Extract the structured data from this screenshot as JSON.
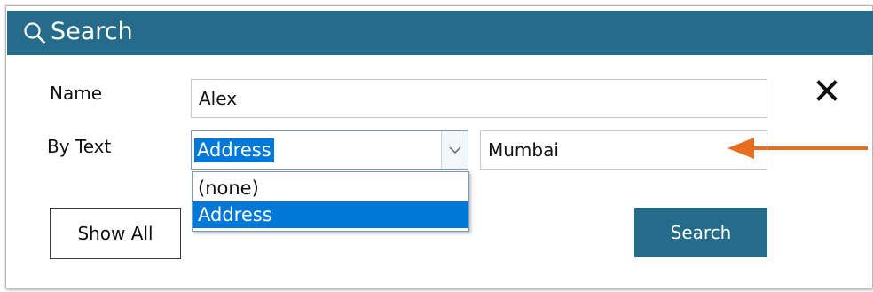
{
  "dialog": {
    "title": "Search",
    "title_icon": "search-icon",
    "close_icon": "close-icon",
    "colors": {
      "titlebar": "#256b8a",
      "selection": "#0078d7",
      "annotation_arrow": "#e86e1f"
    }
  },
  "form": {
    "name_label": "Name",
    "name_value": "Alex",
    "bytext_label": "By Text",
    "bytext_selected": "Address",
    "text_value": "Mumbai"
  },
  "dropdown": {
    "options": [
      "(none)",
      "Address"
    ],
    "highlighted_option": "Address"
  },
  "buttons": {
    "show_all": "Show All",
    "search": "Search"
  }
}
